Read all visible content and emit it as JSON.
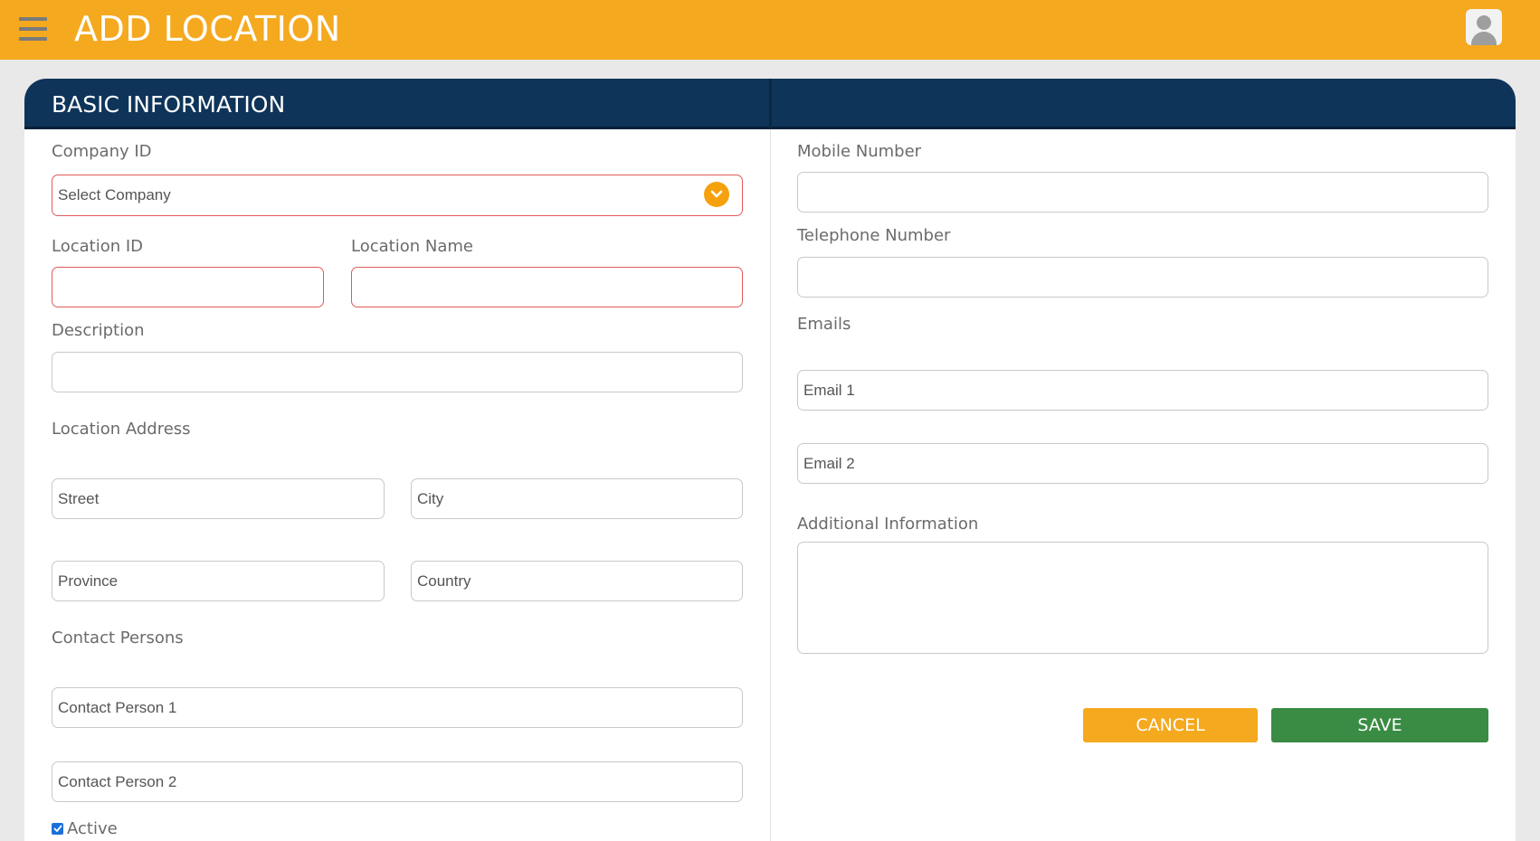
{
  "header": {
    "title": "ADD LOCATION",
    "menu_icon": "hamburger-menu-icon",
    "avatar_icon": "user-avatar-icon"
  },
  "section": {
    "title": "BASIC INFORMATION"
  },
  "left": {
    "company_label": "Company ID",
    "company_select_value": "Select Company",
    "location_id_label": "Location ID",
    "location_id_value": "",
    "location_name_label": "Location Name",
    "location_name_value": "",
    "description_label": "Description",
    "description_value": "",
    "address_label": "Location Address",
    "street_placeholder": "Street",
    "city_placeholder": "City",
    "province_placeholder": "Province",
    "country_placeholder": "Country",
    "contacts_label": "Contact Persons",
    "contact1_placeholder": "Contact Person 1",
    "contact2_placeholder": "Contact Person 2",
    "active_label": "Active",
    "active_checked": true
  },
  "right": {
    "mobile_label": "Mobile Number",
    "mobile_value": "",
    "telephone_label": "Telephone Number",
    "telephone_value": "",
    "emails_label": "Emails",
    "email1_placeholder": "Email 1",
    "email2_placeholder": "Email 2",
    "additional_label": "Additional Information",
    "additional_value": ""
  },
  "actions": {
    "cancel_label": "CANCEL",
    "save_label": "SAVE"
  },
  "colors": {
    "topbar": "#f5a91f",
    "section_header": "#0f3459",
    "required_border": "#e05a5a",
    "save_button": "#3a8b44",
    "cancel_button": "#f5a91f"
  }
}
